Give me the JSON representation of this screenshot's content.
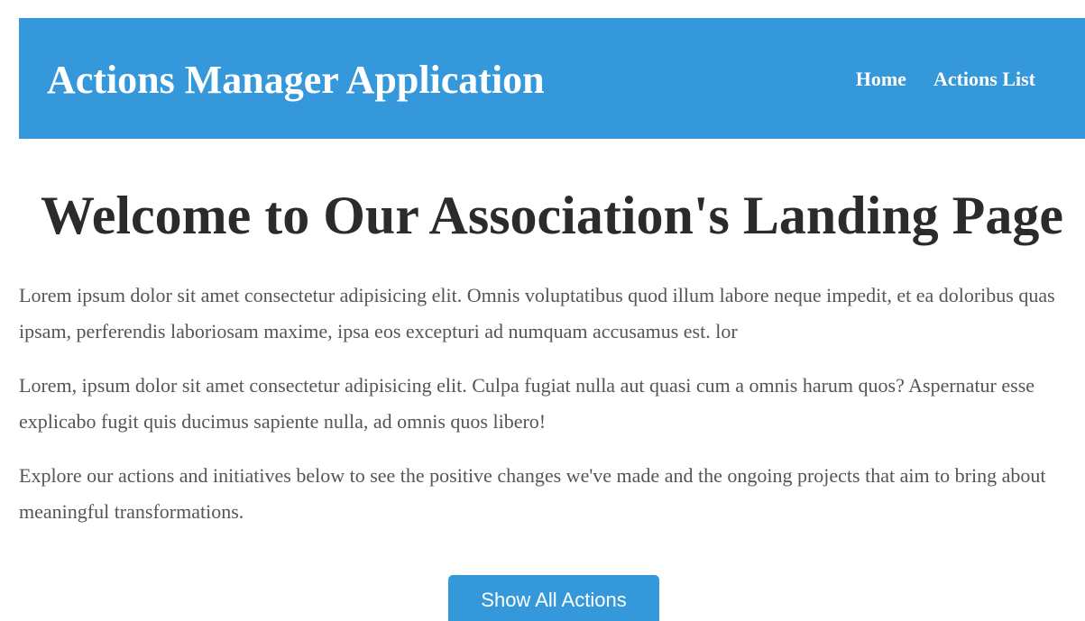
{
  "header": {
    "title": "Actions Manager Application",
    "nav": {
      "home": "Home",
      "actions_list": "Actions List"
    }
  },
  "main": {
    "heading": "Welcome to Our Association's Landing Page",
    "paragraphs": [
      "Lorem ipsum dolor sit amet consectetur adipisicing elit. Omnis voluptatibus quod illum labore neque impedit, et ea doloribus quas ipsam, perferendis laboriosam maxime, ipsa eos excepturi ad numquam accusamus est. lor",
      "Lorem, ipsum dolor sit amet consectetur adipisicing elit. Culpa fugiat nulla aut quasi cum a omnis harum quos? Aspernatur esse explicabo fugit quis ducimus sapiente nulla, ad omnis quos libero!",
      "Explore our actions and initiatives below to see the positive changes we've made and the ongoing projects that aim to bring about meaningful transformations."
    ],
    "cta_button": "Show All Actions"
  },
  "colors": {
    "accent": "#3498db",
    "heading_text": "#2b2b2b",
    "body_text": "#555555"
  }
}
